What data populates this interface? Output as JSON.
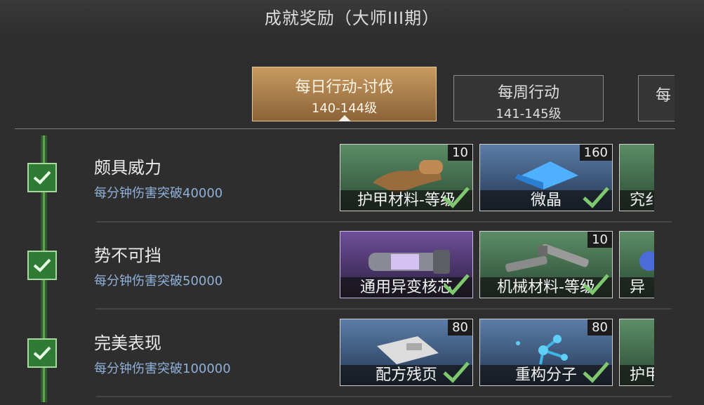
{
  "header": {
    "title": "成就奖励（大师III期）"
  },
  "tabs": [
    {
      "line1": "每日行动-讨伐",
      "line2": "140-144级"
    },
    {
      "line1": "每周行动",
      "line2": "141-145级"
    },
    {
      "line1": "每"
    }
  ],
  "achievements": [
    {
      "title": "颇具威力",
      "desc": "每分钟伤害突破40000",
      "rewards": [
        {
          "name": "护甲材料-等级",
          "count": "10"
        },
        {
          "name": "微晶",
          "count": "160"
        },
        {
          "name": "究纟"
        }
      ]
    },
    {
      "title": "势不可挡",
      "desc": "每分钟伤害突破50000",
      "rewards": [
        {
          "name": "通用异变核芯"
        },
        {
          "name": "机械材料-等级",
          "count": "10"
        },
        {
          "name": "异"
        }
      ]
    },
    {
      "title": "完美表现",
      "desc": "每分钟伤害突破100000",
      "rewards": [
        {
          "name": "配方残页",
          "count": "80"
        },
        {
          "name": "重构分子",
          "count": "80"
        },
        {
          "name": "护甲"
        }
      ]
    }
  ],
  "colors": {
    "accent": "#c89a62",
    "check": "#2f7b33",
    "desc": "#8fb0d8"
  }
}
